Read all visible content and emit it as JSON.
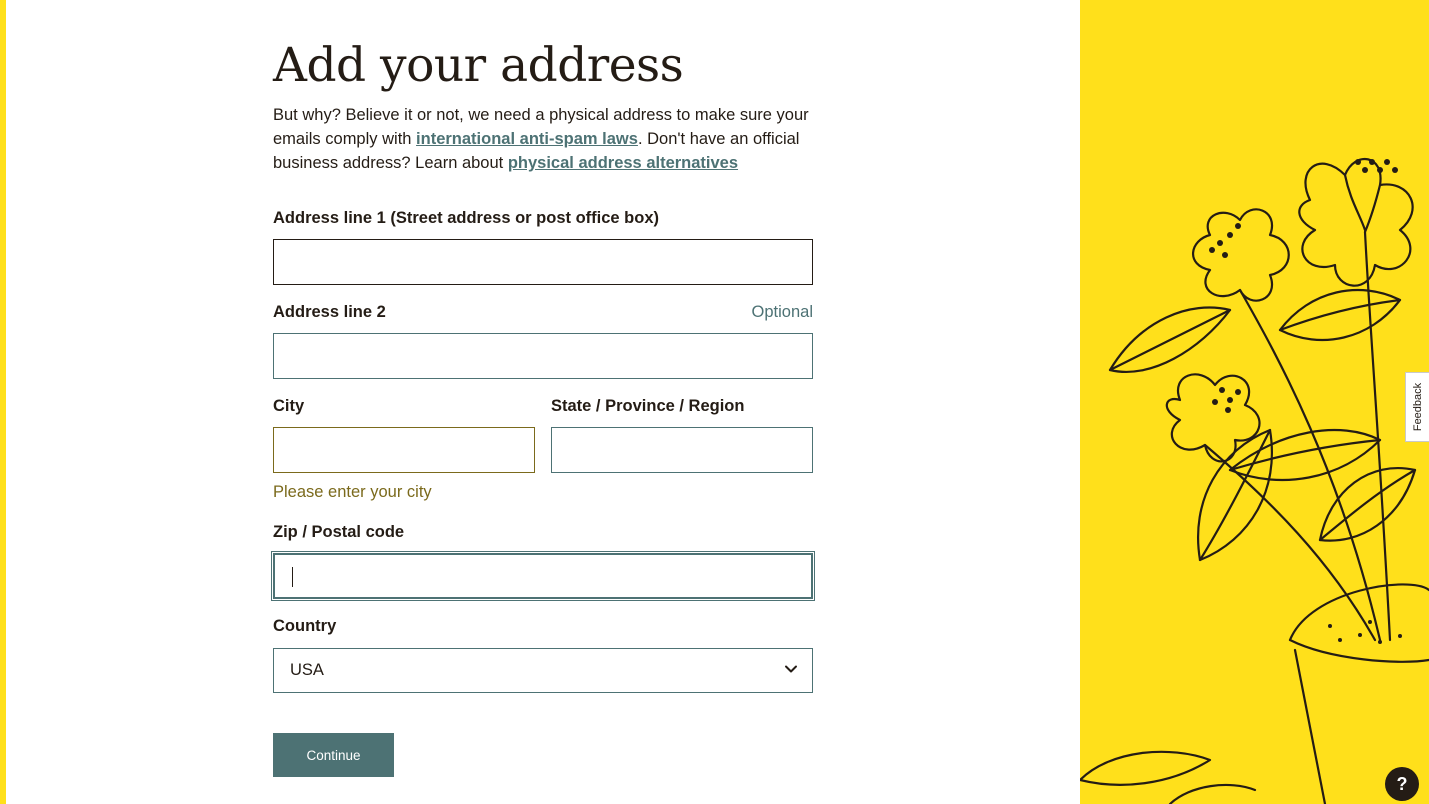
{
  "title": "Add your address",
  "intro": {
    "text_1": "But why? Believe it or not, we need a physical address to make sure your emails comply with ",
    "link_1": "international anti-spam laws",
    "text_2": ". Don't have an official business address? Learn about ",
    "link_2": "physical address alternatives"
  },
  "fields": {
    "address1": {
      "label": "Address line 1 (Street address or post office box)",
      "value": ""
    },
    "address2": {
      "label": "Address line 2",
      "optional": "Optional",
      "value": ""
    },
    "city": {
      "label": "City",
      "value": "",
      "error": "Please enter your city"
    },
    "state": {
      "label": "State / Province / Region",
      "value": ""
    },
    "zip": {
      "label": "Zip / Postal code",
      "value": ""
    },
    "country": {
      "label": "Country",
      "value": "USA"
    }
  },
  "continue_label": "Continue",
  "feedback_label": "Feedback",
  "help_label": "?",
  "colors": {
    "brand_yellow": "#ffe01b",
    "accent_teal": "#4d7274",
    "error_olive": "#7b6a1c",
    "text_dark": "#241c15"
  },
  "icons": {
    "country_dropdown": "chevron-down-icon",
    "help": "question-mark-icon",
    "illustration": "flower-pot-illustration"
  }
}
